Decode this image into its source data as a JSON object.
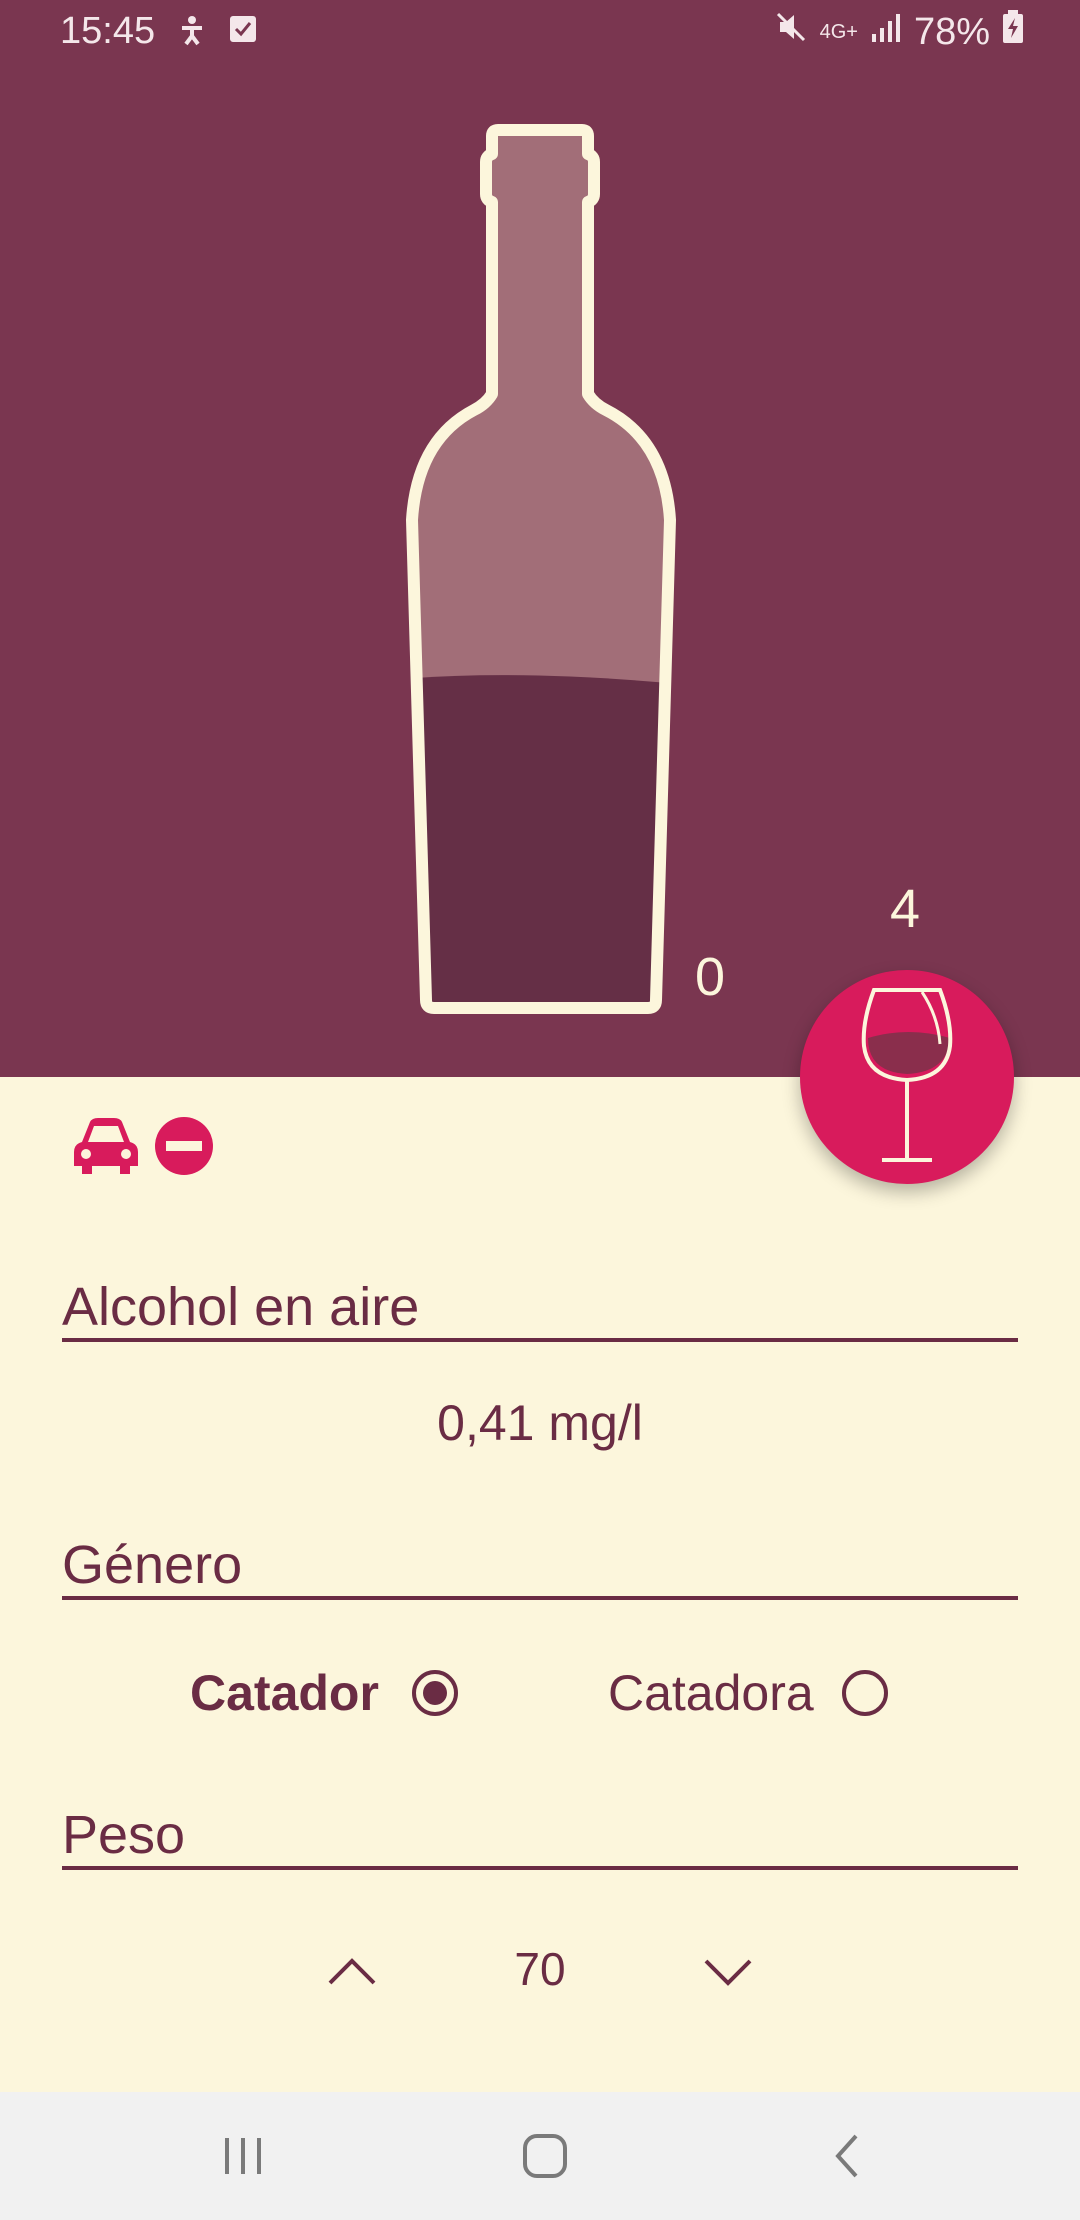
{
  "status_bar": {
    "time": "15:45",
    "network": "4G+",
    "battery": "78%"
  },
  "bottle": {
    "count": "0",
    "fill_level_fraction": 0.55
  },
  "glass": {
    "count": "4"
  },
  "colors": {
    "header_bg": "#7A3650",
    "body_bg": "#FCF6DC",
    "accent": "#D81B5C",
    "text": "#6A2C44"
  },
  "icons": [
    "car-icon",
    "no-entry-icon",
    "wine-glass-icon",
    "radio-selected-icon",
    "radio-unselected-icon",
    "chevron-up-icon",
    "chevron-down-icon"
  ],
  "alcohol": {
    "title": "Alcohol en aire",
    "value": "0,41 mg/l"
  },
  "gender": {
    "title": "Género",
    "options": [
      {
        "label": "Catador",
        "selected": true
      },
      {
        "label": "Catadora",
        "selected": false
      }
    ]
  },
  "weight": {
    "title": "Peso",
    "value": "70"
  }
}
